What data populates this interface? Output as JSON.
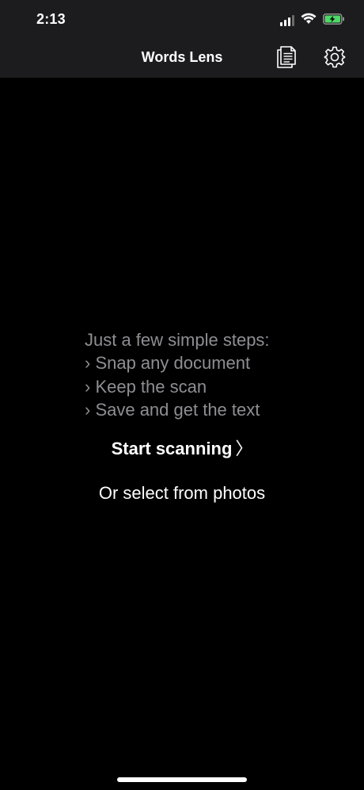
{
  "status_bar": {
    "time": "2:13",
    "battery_color": "#4cd964"
  },
  "nav": {
    "title": "Words Lens",
    "icons": [
      "documents-icon",
      "gear-icon"
    ]
  },
  "onboarding": {
    "intro": "Just a few simple steps:",
    "steps": [
      "› Snap any document",
      "› Keep the scan",
      "› Save and get the text"
    ],
    "start_label": "Start scanning",
    "start_chevron": "〉",
    "select_photos_label": "Or select from photos"
  },
  "colors": {
    "background": "#000000",
    "bar": "#1c1c1e",
    "muted_text": "#8e8e93",
    "text": "#ffffff"
  }
}
